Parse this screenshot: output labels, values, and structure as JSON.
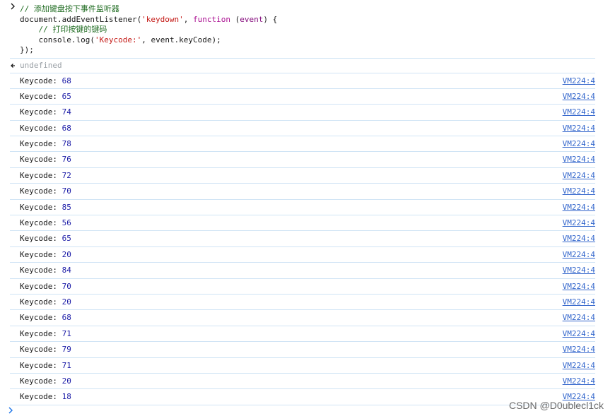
{
  "input": {
    "lines": [
      {
        "parts": [
          {
            "t": "comment",
            "v": "// 添加键盘按下事件监听器"
          }
        ]
      },
      {
        "parts": [
          {
            "t": "plain",
            "v": "document.addEventListener("
          },
          {
            "t": "string",
            "v": "'keydown'"
          },
          {
            "t": "plain",
            "v": ", "
          },
          {
            "t": "keyword",
            "v": "function"
          },
          {
            "t": "plain",
            "v": " ("
          },
          {
            "t": "kw2",
            "v": "event"
          },
          {
            "t": "plain",
            "v": ") {"
          }
        ]
      },
      {
        "parts": [
          {
            "t": "plain",
            "v": "    "
          },
          {
            "t": "comment",
            "v": "// 打印按键的键码"
          }
        ]
      },
      {
        "parts": [
          {
            "t": "plain",
            "v": "    console.log("
          },
          {
            "t": "string",
            "v": "'Keycode:'"
          },
          {
            "t": "plain",
            "v": ", event.keyCode);"
          }
        ]
      },
      {
        "parts": [
          {
            "t": "plain",
            "v": "});"
          }
        ]
      }
    ]
  },
  "result": {
    "value": "undefined"
  },
  "logs": {
    "label": "Keycode:",
    "source": "VM224:4",
    "values": [
      68,
      65,
      74,
      68,
      78,
      76,
      72,
      70,
      85,
      56,
      65,
      20,
      84,
      70,
      20,
      68,
      71,
      79,
      71,
      20,
      18
    ]
  },
  "watermark": "CSDN @D0ublecl1ck",
  "colors": {
    "comment": "#236e25",
    "string": "#c41a16",
    "keyword": "#aa0d91",
    "number": "#1a1aa6",
    "link": "#3366cc",
    "divider": "#d0e4f5"
  },
  "icons": {
    "input_prompt": "chevron-right-icon",
    "result_arrow": "return-arrow-icon",
    "bottom_prompt": "chevron-right-icon"
  }
}
